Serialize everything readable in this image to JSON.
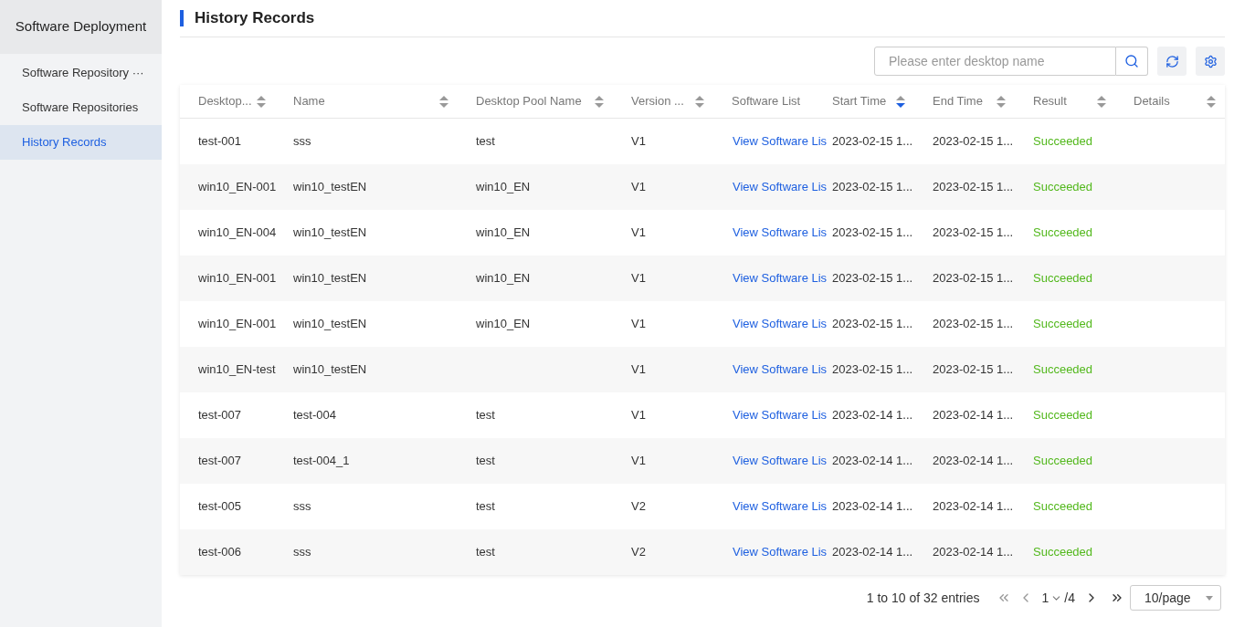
{
  "sidebar": {
    "title": "Software Deployment",
    "items": [
      {
        "label": "Software Repository ···",
        "selected": false
      },
      {
        "label": "Software Repositories",
        "selected": false
      },
      {
        "label": "History Records",
        "selected": true
      }
    ]
  },
  "page_title": "History Records",
  "search": {
    "placeholder": "Please enter desktop name"
  },
  "table": {
    "columns": [
      {
        "label": "Desktop...",
        "sorted_descending": false
      },
      {
        "label": "Name",
        "sorted_descending": false
      },
      {
        "label": "Desktop Pool Name",
        "sorted_descending": false
      },
      {
        "label": "Version ...",
        "sorted_descending": false
      },
      {
        "label": "Software List"
      },
      {
        "label": "Start Time",
        "sorted_descending": true
      },
      {
        "label": "End Time",
        "sorted_descending": false
      },
      {
        "label": "Result",
        "sorted_descending": false
      },
      {
        "label": "Details",
        "sorted_descending": false
      }
    ],
    "rows": [
      [
        "test-001",
        "sss",
        "test",
        "V1",
        "View Software Lis",
        "2023-02-15 1...",
        "2023-02-15 1...",
        "Succeeded"
      ],
      [
        "win10_EN-001",
        "win10_testEN",
        "win10_EN",
        "V1",
        "View Software Lis",
        "2023-02-15 1...",
        "2023-02-15 1...",
        "Succeeded"
      ],
      [
        "win10_EN-004",
        "win10_testEN",
        "win10_EN",
        "V1",
        "View Software Lis",
        "2023-02-15 1...",
        "2023-02-15 1...",
        "Succeeded"
      ],
      [
        "win10_EN-001",
        "win10_testEN",
        "win10_EN",
        "V1",
        "View Software Lis",
        "2023-02-15 1...",
        "2023-02-15 1...",
        "Succeeded"
      ],
      [
        "win10_EN-001",
        "win10_testEN",
        "win10_EN",
        "V1",
        "View Software Lis",
        "2023-02-15 1...",
        "2023-02-15 1...",
        "Succeeded"
      ],
      [
        "win10_EN-test",
        "win10_testEN",
        "",
        "V1",
        "View Software Lis",
        "2023-02-15 1...",
        "2023-02-15 1...",
        "Succeeded"
      ],
      [
        "test-007",
        "test-004",
        "test",
        "V1",
        "View Software Lis",
        "2023-02-14 1...",
        "2023-02-14 1...",
        "Succeeded"
      ],
      [
        "test-007",
        "test-004_1",
        "test",
        "V1",
        "View Software Lis",
        "2023-02-14 1...",
        "2023-02-14 1...",
        "Succeeded"
      ],
      [
        "test-005",
        "sss",
        "test",
        "V2",
        "View Software Lis",
        "2023-02-14 1...",
        "2023-02-14 1...",
        "Succeeded"
      ],
      [
        "test-006",
        "sss",
        "test",
        "V2",
        "View Software Lis",
        "2023-02-14 1...",
        "2023-02-14 1...",
        "Succeeded"
      ]
    ]
  },
  "pagination": {
    "summary": "1 to 10 of 32 entries",
    "page": "1",
    "total": "/4",
    "page_size": "10/page"
  }
}
